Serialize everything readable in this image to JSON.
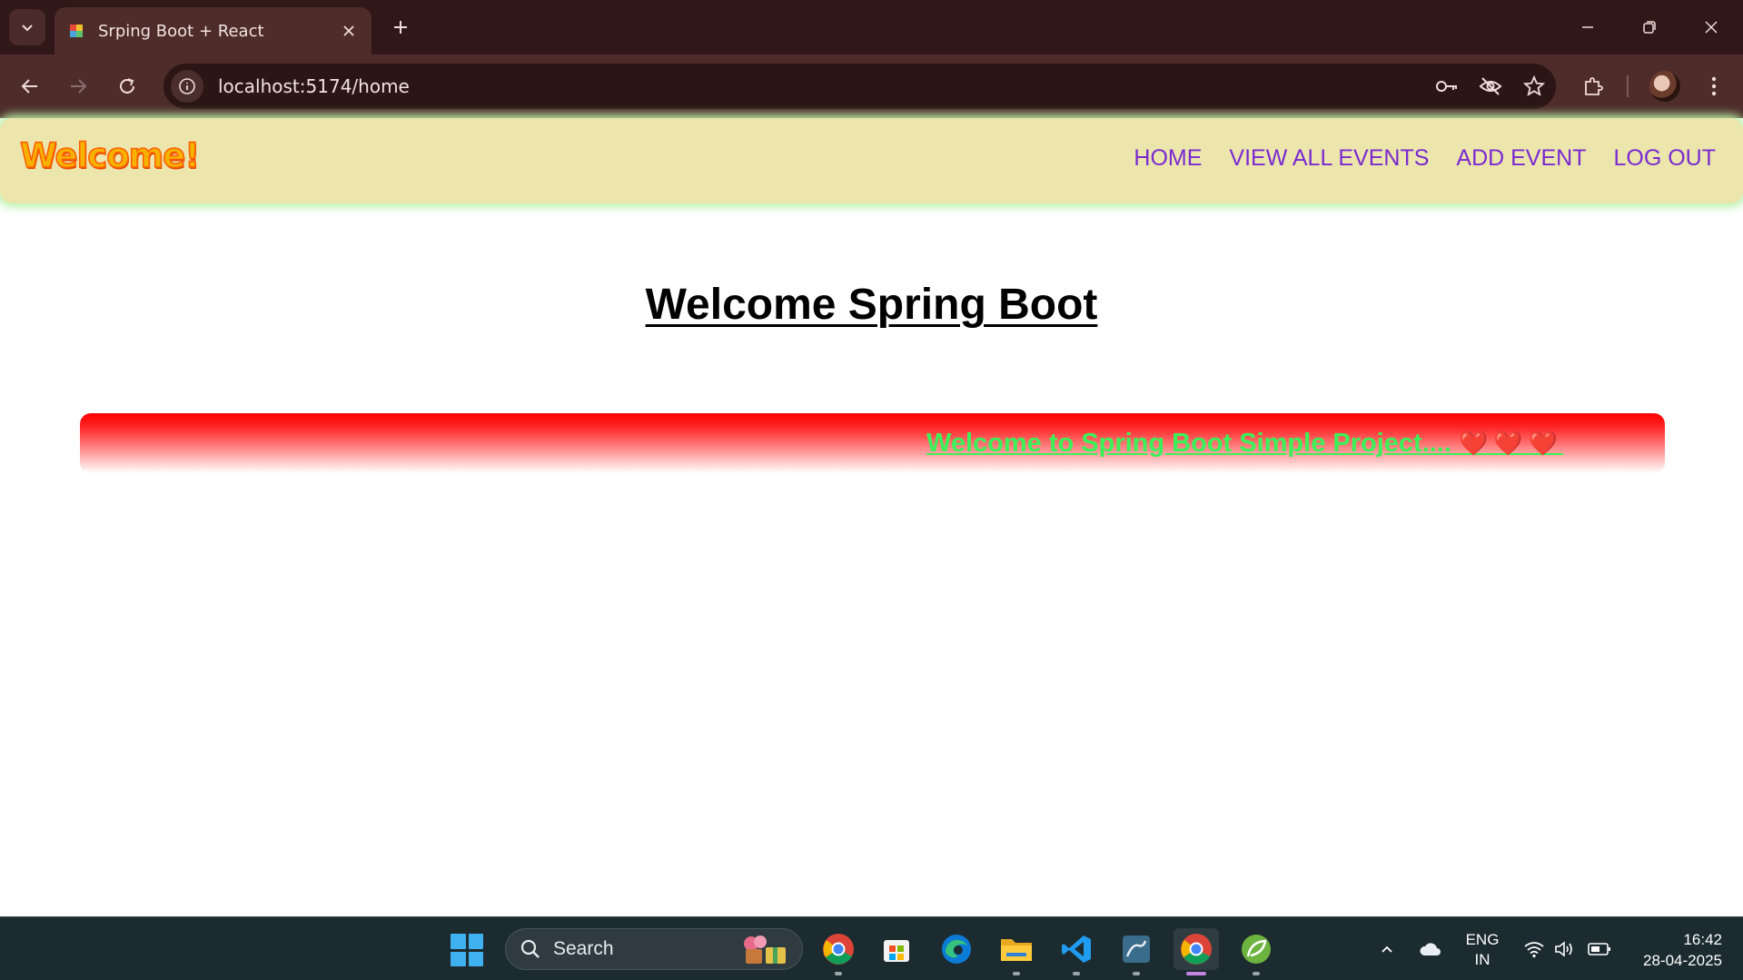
{
  "browser": {
    "tab": {
      "title": "Srping Boot + React",
      "favicon": "puzzle-favicon-icon"
    },
    "url": "localhost:5174/home",
    "icons": [
      "tab-search-icon",
      "close-icon",
      "plus-icon",
      "minimize-icon",
      "restore-icon",
      "close-window-icon",
      "back-icon",
      "forward-icon",
      "reload-icon",
      "site-info-icon",
      "key-icon",
      "eye-off-icon",
      "star-icon",
      "extensions-icon",
      "profile-avatar",
      "more-icon"
    ]
  },
  "app": {
    "brand": "Welcome!",
    "nav": [
      {
        "label": "HOME"
      },
      {
        "label": "VIEW ALL EVENTS"
      },
      {
        "label": "ADD EVENT"
      },
      {
        "label": "LOG OUT"
      }
    ],
    "heading": "Welcome Spring Boot",
    "banner_text": "Welcome to Spring Boot Simple Project....",
    "banner_hearts": "❤️❤️❤️",
    "colors": {
      "navbar_bg": "#ece6ad",
      "navbar_glow": "#b8f0a6",
      "nav_link": "#7b2ad0",
      "brand": "#f7b100",
      "banner_top": "#ff0000",
      "banner_text": "#3cf05a"
    }
  },
  "taskbar": {
    "search_placeholder": "Search",
    "apps": [
      "chrome-icon",
      "microsoft-store-icon",
      "edge-icon",
      "file-explorer-icon",
      "vscode-icon",
      "mysql-workbench-icon",
      "chrome-active-icon",
      "spring-tools-icon"
    ],
    "tray": {
      "lang_line1": "ENG",
      "lang_line2": "IN",
      "time": "16:42",
      "date": "28-04-2025"
    }
  }
}
